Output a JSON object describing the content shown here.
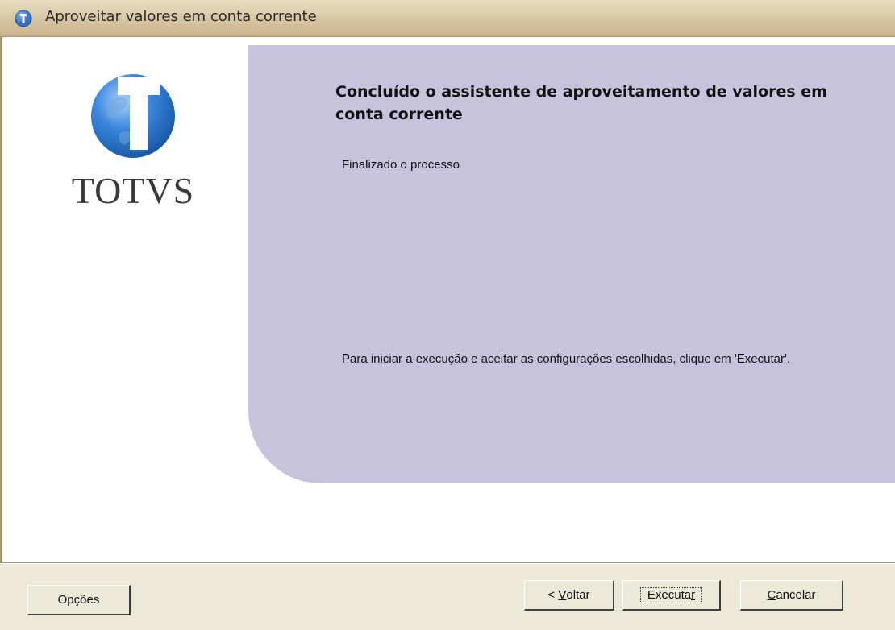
{
  "window": {
    "title": "Aproveitar valores em conta corrente",
    "icon": "totvs-globe-icon"
  },
  "logo": {
    "text": "TOTVS"
  },
  "content": {
    "heading": "Concluído o assistente de aproveitamento de valores em conta corrente",
    "status": "Finalizado o processo",
    "instruction": "Para iniciar a execução e aceitar as configurações escolhidas, clique em 'Executar'."
  },
  "buttons": {
    "options_label": "Opções",
    "back_prefix": "< ",
    "back_mnemonic": "V",
    "back_rest": "oltar",
    "run_main": "Executa",
    "run_mnemonic": "r",
    "cancel_mnemonic": "C",
    "cancel_rest": "ancelar"
  },
  "colors": {
    "panel": "#c7c3dd",
    "titlebar": "#d9c9a6"
  }
}
